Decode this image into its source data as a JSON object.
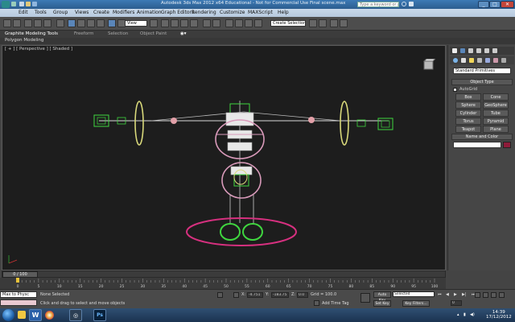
{
  "window": {
    "title": "Autodesk 3ds Max  2012 x64   Educational - Not for Commercial Use    Final scene.max",
    "search_placeholder": "Type a keyword or phrase",
    "controls": {
      "minimize": "_",
      "maximize": "□",
      "close": "✕"
    }
  },
  "menu": {
    "items": [
      "Edit",
      "Tools",
      "Group",
      "Views",
      "Create",
      "Modifiers",
      "Animation",
      "Graph Editors",
      "Rendering",
      "Customize",
      "MAXScript",
      "Help"
    ]
  },
  "toolbar": {
    "ref_coord": "View",
    "selection_set": "Create Selection Se"
  },
  "ribbon": {
    "tabs": [
      "Graphite Modeling Tools",
      "Freeform",
      "Selection",
      "Object Paint"
    ],
    "sub_label": "Polygon Modeling"
  },
  "viewport": {
    "label": "[ + ] [ Perspective ] [ Shaded ]"
  },
  "command_panel": {
    "category": "Standard Primitives",
    "object_type_header": "Object Type",
    "autogrid_label": "AutoGrid",
    "primitives": [
      "Box",
      "Cone",
      "Sphere",
      "GeoSphere",
      "Cylinder",
      "Tube",
      "Torus",
      "Pyramid",
      "Teapot",
      "Plane"
    ],
    "name_color_header": "Name and Color",
    "object_color": "#8e1c3a"
  },
  "timeline": {
    "frame_display": "0 / 100",
    "ticks": [
      "0",
      "5",
      "10",
      "15",
      "20",
      "25",
      "30",
      "35",
      "40",
      "45",
      "50",
      "55",
      "60",
      "65",
      "70",
      "75",
      "80",
      "85",
      "90",
      "95",
      "100"
    ]
  },
  "status": {
    "maxscript_label": "Max to Physc",
    "selection": "None Selected",
    "prompt": "Click and drag to select and move objects",
    "x_label": "X:",
    "x_value": "-4.751",
    "y_label": "Y:",
    "y_value": "-183.75",
    "z_label": "Z:",
    "z_value": "0.0",
    "grid": "Grid = 100.0",
    "add_time_tag": "Add Time Tag",
    "auto_key": "Auto Key",
    "set_key": "Set Key",
    "key_mode": "Selected",
    "key_filters": "Key Filters...",
    "frame_value": "0"
  },
  "taskbar": {
    "apps": [
      "W",
      "◎",
      "Ps"
    ],
    "time": "14:39",
    "date": "17/12/2012"
  },
  "colors": {
    "wire_pink": "#d99aba",
    "wire_yellow": "#d8d87a",
    "wire_green": "#3fd63f",
    "ground_ring": "#d6307f"
  }
}
